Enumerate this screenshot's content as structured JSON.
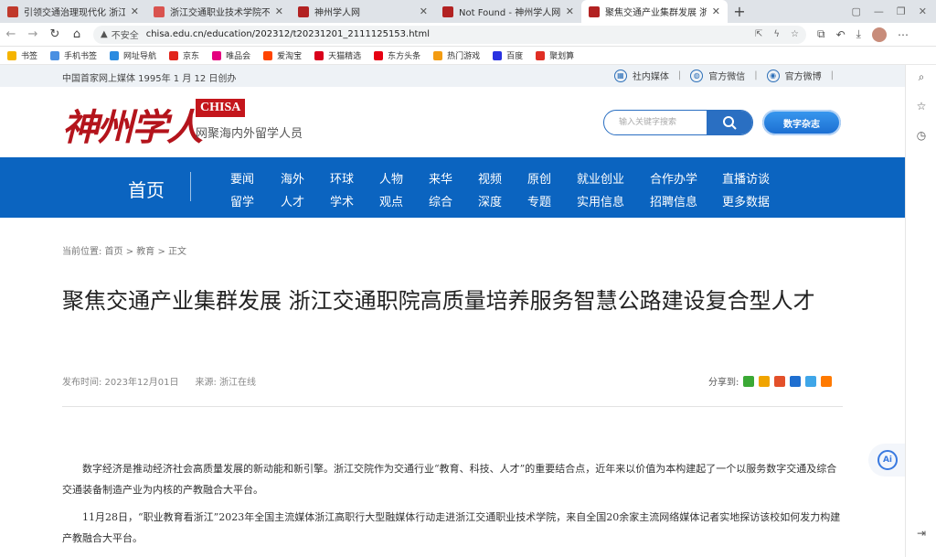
{
  "browser": {
    "tabs": [
      {
        "title": "引领交通治理现代化 浙江交通",
        "active": false,
        "color": "#c0392b"
      },
      {
        "title": "浙江交通职业技术学院不断为",
        "active": false,
        "color": "#d9534f"
      },
      {
        "title": "神州学人网",
        "active": false,
        "color": "#b22222"
      },
      {
        "title": "Not Found - 神州学人网",
        "active": false,
        "color": "#b22222"
      },
      {
        "title": "聚焦交通产业集群发展 浙江交",
        "active": true,
        "color": "#b22222"
      }
    ],
    "new_tab": "+",
    "security_label": "不安全",
    "url": "chisa.edu.cn/education/202312/t20231201_2111125153.html",
    "bookmarks": [
      {
        "label": "书签",
        "color": "#f5b400"
      },
      {
        "label": "手机书签",
        "color": "#4a90e2"
      },
      {
        "label": "网址导航",
        "color": "#2b8be0"
      },
      {
        "label": "京东",
        "color": "#e1251b"
      },
      {
        "label": "唯品会",
        "color": "#e4007f"
      },
      {
        "label": "爱淘宝",
        "color": "#ff4400"
      },
      {
        "label": "天猫精选",
        "color": "#d9001b"
      },
      {
        "label": "东方头条",
        "color": "#e60012"
      },
      {
        "label": "热门游戏",
        "color": "#f39c12"
      },
      {
        "label": "百度",
        "color": "#2932e1"
      },
      {
        "label": "聚划算",
        "color": "#e02e24"
      }
    ]
  },
  "topbar": {
    "since": "中国首家网上媒体 1995年 1 月 12 日创办",
    "links": [
      "社内媒体",
      "官方微信",
      "官方微博"
    ]
  },
  "header": {
    "logo_cn": "神州学人",
    "logo_badge": "CHISA",
    "tagline": "网聚海内外留学人员",
    "search_placeholder": "输入关键字搜索",
    "magazine": "数字杂志"
  },
  "nav": {
    "home": "首页",
    "row1": [
      "要闻",
      "海外",
      "环球",
      "人物",
      "来华",
      "视频",
      "原创",
      "就业创业",
      "合作办学",
      "直播访谈"
    ],
    "row2": [
      "留学",
      "人才",
      "学术",
      "观点",
      "综合",
      "深度",
      "专题",
      "实用信息",
      "招聘信息",
      "更多数据"
    ]
  },
  "article": {
    "breadcrumb": "当前位置:  首页 > 教育 > 正文",
    "title": "聚焦交通产业集群发展 浙江交通职院高质量培养服务智慧公路建设复合型人才",
    "publish": "发布时间:   2023年12月01日",
    "source": "来源:   浙江在线",
    "share_label": "分享到:",
    "share_colors": [
      "#3aa935",
      "#f0a400",
      "#e3502a",
      "#1f6fd0",
      "#3fa6e8",
      "#ff7a00"
    ],
    "paragraphs": [
      "数字经济是推动经济社会高质量发展的新动能和新引擎。浙江交院作为交通行业“教育、科技、人才”的重要结合点，近年来以价值为本构建起了一个以服务数字交通及综合交通装备制造产业为内核的产教融合大平台。",
      "11月28日，“职业教育看浙江”2023年全国主流媒体浙江高职行大型融媒体行动走进浙江交通职业技术学院，来自全国20余家主流网络媒体记者实地探访该校如何发力构建产教融合大平台。"
    ]
  },
  "ai_label": "Ai"
}
